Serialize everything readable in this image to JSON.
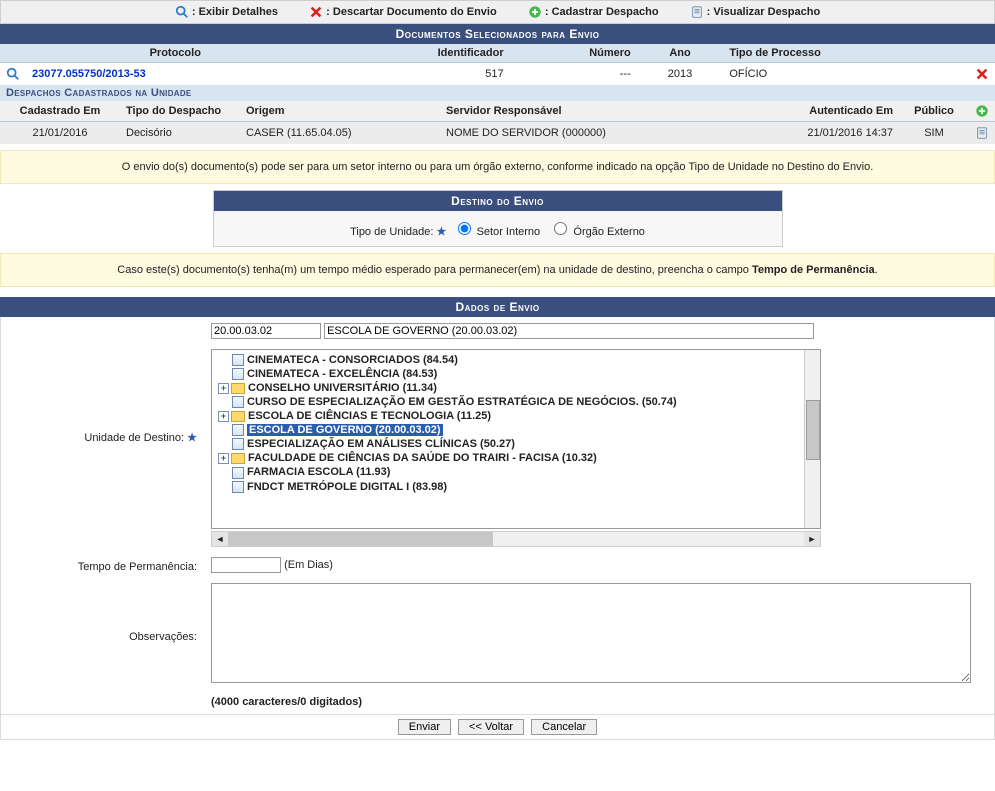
{
  "legend": {
    "exibir": "Exibir Detalhes",
    "descartar": "Descartar Documento do Envio",
    "cadastrar": "Cadastrar Despacho",
    "visualizar": "Visualizar Despacho"
  },
  "docs_header": "Documentos Selecionados para Envio",
  "docs_cols": {
    "protocolo": "Protocolo",
    "identificador": "Identificador",
    "numero": "Número",
    "ano": "Ano",
    "tipo": "Tipo de Processo"
  },
  "doc_row": {
    "protocolo": "23077.055750/2013-53",
    "identificador": "517",
    "numero": "---",
    "ano": "2013",
    "tipo": "OFÍCIO"
  },
  "despachos_header": "Despachos Cadastrados na Unidade",
  "despachos_cols": {
    "cadastrado": "Cadastrado Em",
    "tipo": "Tipo do Despacho",
    "origem": "Origem",
    "servidor": "Servidor Responsável",
    "autenticado": "Autenticado Em",
    "publico": "Público"
  },
  "despacho_row": {
    "cadastrado": "21/01/2016",
    "tipo": "Decisório",
    "origem": "CASER (11.65.04.05)",
    "servidor": "NOME DO SERVIDOR (000000)",
    "autenticado": "21/01/2016 14:37",
    "publico": "SIM"
  },
  "info1": "O envio do(s) documento(s) pode ser para um setor interno ou para um órgão externo, conforme indicado na opção Tipo de Unidade no Destino do Envio.",
  "destino_header": "Destino do Envio",
  "destino_label": "Tipo de Unidade:",
  "destino_setor": "Setor Interno",
  "destino_orgao": "Órgão Externo",
  "info2_prefix": "Caso este(s) documento(s) tenha(m) um tempo médio esperado para permanecer(em) na unidade de destino, preencha o campo ",
  "info2_bold": "Tempo de Permanência",
  "dados_header": "Dados de Envio",
  "unidade_label": "Unidade de Destino:",
  "unidade_code": "20.00.03.02",
  "unidade_name": "ESCOLA DE GOVERNO (20.00.03.02)",
  "tree": {
    "n0": "CINEMATECA - CONSORCIADOS (84.54)",
    "n1": "CINEMATECA - EXCELÊNCIA (84.53)",
    "n2": "CONSELHO UNIVERSITÁRIO (11.34)",
    "n3": "CURSO DE ESPECIALIZAÇÃO EM GESTÃO ESTRATÉGICA DE NEGÓCIOS. (50.74)",
    "n4": "ESCOLA DE CIÊNCIAS E TECNOLOGIA (11.25)",
    "n5": "ESCOLA DE GOVERNO (20.00.03.02)",
    "n6": "ESPECIALIZAÇÃO EM ANÁLISES CLÍNICAS (50.27)",
    "n7": "FACULDADE DE CIÊNCIAS DA SAÚDE DO TRAIRI - FACISA (10.32)",
    "n8": "FARMACIA ESCOLA (11.93)",
    "n9": "FNDCT METRÓPOLE DIGITAL I (83.98)"
  },
  "tempo_label": "Tempo de Permanência:",
  "tempo_hint": "(Em Dias)",
  "obs_label": "Observações:",
  "char_count": "(4000 caracteres/0 digitados)",
  "buttons": {
    "enviar": "Enviar",
    "voltar": "<< Voltar",
    "cancelar": "Cancelar"
  }
}
